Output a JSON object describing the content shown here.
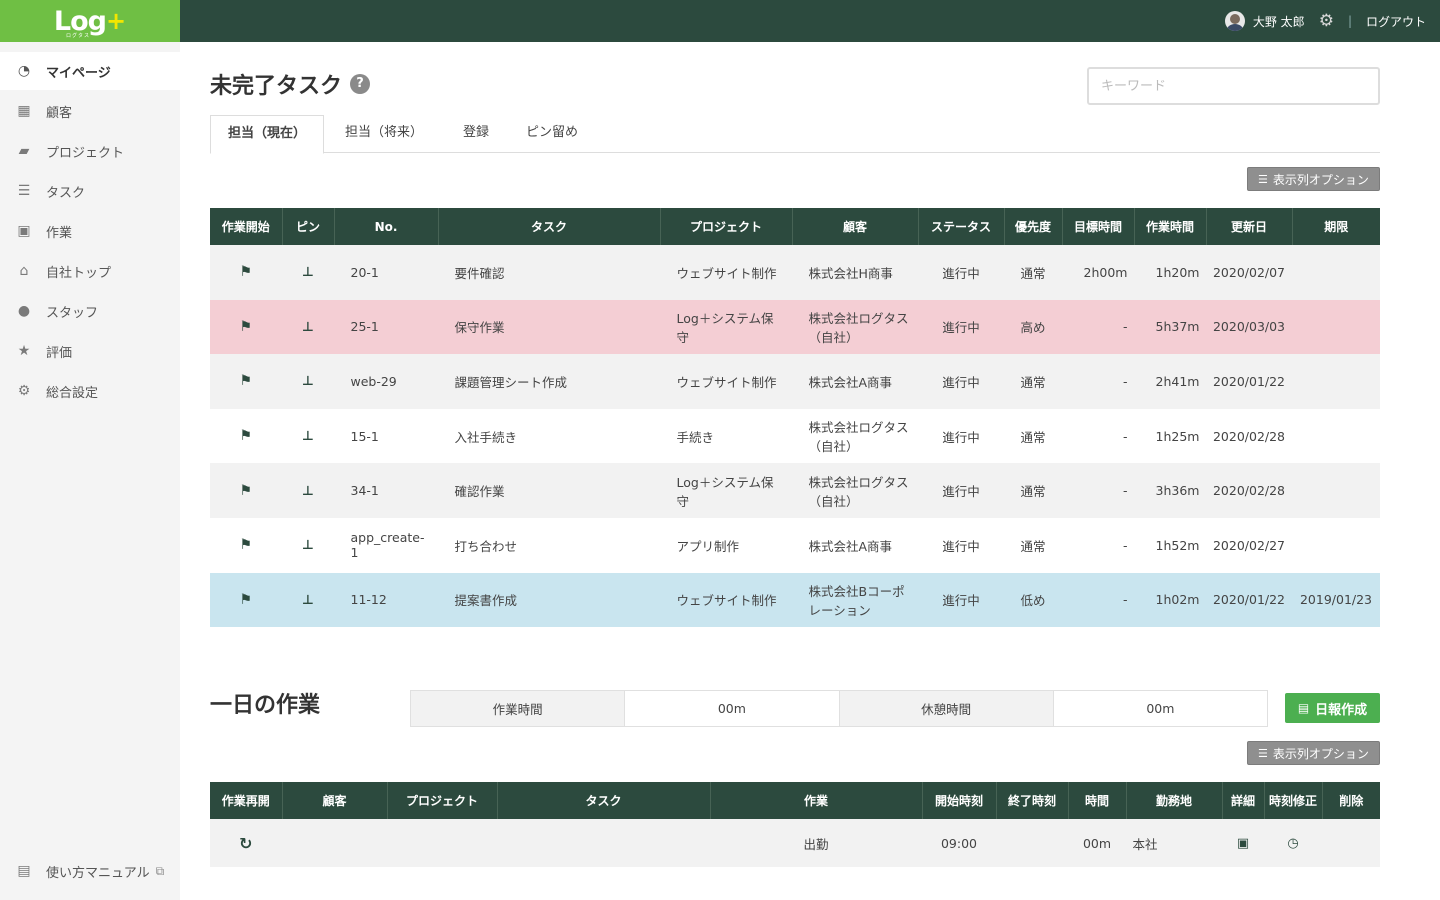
{
  "header": {
    "logo": "Log",
    "logo_plus": "+",
    "logo_sub": "ログタス",
    "user_name": "大野 太郎",
    "logout_label": "ログアウト",
    "separator": "|"
  },
  "sidebar": {
    "items": [
      {
        "label": "マイページ",
        "icon": "dashboard-icon",
        "glyph": "◔",
        "active": true
      },
      {
        "label": "顧客",
        "icon": "building-icon",
        "glyph": "▦"
      },
      {
        "label": "プロジェクト",
        "icon": "folder-open-icon",
        "glyph": "▰"
      },
      {
        "label": "タスク",
        "icon": "task-list-icon",
        "glyph": "☰"
      },
      {
        "label": "作業",
        "icon": "briefcase-icon",
        "glyph": "▣"
      },
      {
        "label": "自社トップ",
        "icon": "home-icon",
        "glyph": "⌂"
      },
      {
        "label": "スタッフ",
        "icon": "users-icon",
        "glyph": "●"
      },
      {
        "label": "評価",
        "icon": "star-icon",
        "glyph": "★"
      },
      {
        "label": "総合設定",
        "icon": "gear-icon",
        "glyph": "⚙"
      }
    ],
    "manual": {
      "label": "使い方マニュアル",
      "icon": "book-icon",
      "glyph": "▤",
      "ext_glyph": "⧉"
    }
  },
  "page": {
    "title": "未完了タスク",
    "help_glyph": "?",
    "search_placeholder": "キーワード",
    "tabs": [
      "担当（現在）",
      "担当（将来）",
      "登録",
      "ピン留め"
    ],
    "column_options_label": "表示列オプション"
  },
  "task_table": {
    "headers": [
      "作業開始",
      "ピン",
      "No.",
      "タスク",
      "プロジェクト",
      "顧客",
      "ステータス",
      "優先度",
      "目標時間",
      "作業時間",
      "更新日",
      "期限"
    ],
    "rows": [
      {
        "no": "20-1",
        "task": "要件確認",
        "project": "ウェブサイト制作",
        "client": "株式会社H商事",
        "status": "進行中",
        "priority": "通常",
        "target": "2h00m",
        "worked": "1h20m",
        "updated": "2020/02/07",
        "due": "",
        "highlight": ""
      },
      {
        "no": "25-1",
        "task": "保守作業",
        "project": "Log＋システム保守",
        "client": "株式会社ログタス（自社）",
        "status": "進行中",
        "priority": "高め",
        "target": "-",
        "worked": "5h37m",
        "updated": "2020/03/03",
        "due": "",
        "highlight": "red"
      },
      {
        "no": "web-29",
        "task": "課題管理シート作成",
        "project": "ウェブサイト制作",
        "client": "株式会社A商事",
        "status": "進行中",
        "priority": "通常",
        "target": "-",
        "worked": "2h41m",
        "updated": "2020/01/22",
        "due": "",
        "highlight": ""
      },
      {
        "no": "15-1",
        "task": "入社手続き",
        "project": "手続き",
        "client": "株式会社ログタス（自社）",
        "status": "進行中",
        "priority": "通常",
        "target": "-",
        "worked": "1h25m",
        "updated": "2020/02/28",
        "due": "",
        "highlight": ""
      },
      {
        "no": "34-1",
        "task": "確認作業",
        "project": "Log＋システム保守",
        "client": "株式会社ログタス（自社）",
        "status": "進行中",
        "priority": "通常",
        "target": "-",
        "worked": "3h36m",
        "updated": "2020/02/28",
        "due": "",
        "highlight": ""
      },
      {
        "no": "app_create-1",
        "task": "打ち合わせ",
        "project": "アプリ制作",
        "client": "株式会社A商事",
        "status": "進行中",
        "priority": "通常",
        "target": "-",
        "worked": "1h52m",
        "updated": "2020/02/27",
        "due": "",
        "highlight": ""
      },
      {
        "no": "11-12",
        "task": "提案書作成",
        "project": "ウェブサイト制作",
        "client": "株式会社Bコーポレーション",
        "status": "進行中",
        "priority": "低め",
        "target": "-",
        "worked": "1h02m",
        "updated": "2020/01/22",
        "due": "2019/01/23",
        "highlight": "blue"
      }
    ]
  },
  "daily": {
    "title": "一日の作業",
    "work_time_label": "作業時間",
    "work_time_value": "00m",
    "break_time_label": "休憩時間",
    "break_time_value": "00m",
    "create_report_label": "日報作成",
    "column_options_label": "表示列オプション"
  },
  "work_table": {
    "headers": [
      "作業再開",
      "顧客",
      "プロジェクト",
      "タスク",
      "作業",
      "開始時刻",
      "終了時刻",
      "時間",
      "勤務地",
      "詳細",
      "時刻修正",
      "削除"
    ],
    "rows": [
      {
        "client": "",
        "project": "",
        "task": "",
        "work": "出勤",
        "start": "09:00",
        "end": "",
        "duration": "00m",
        "location": "本社"
      }
    ]
  }
}
